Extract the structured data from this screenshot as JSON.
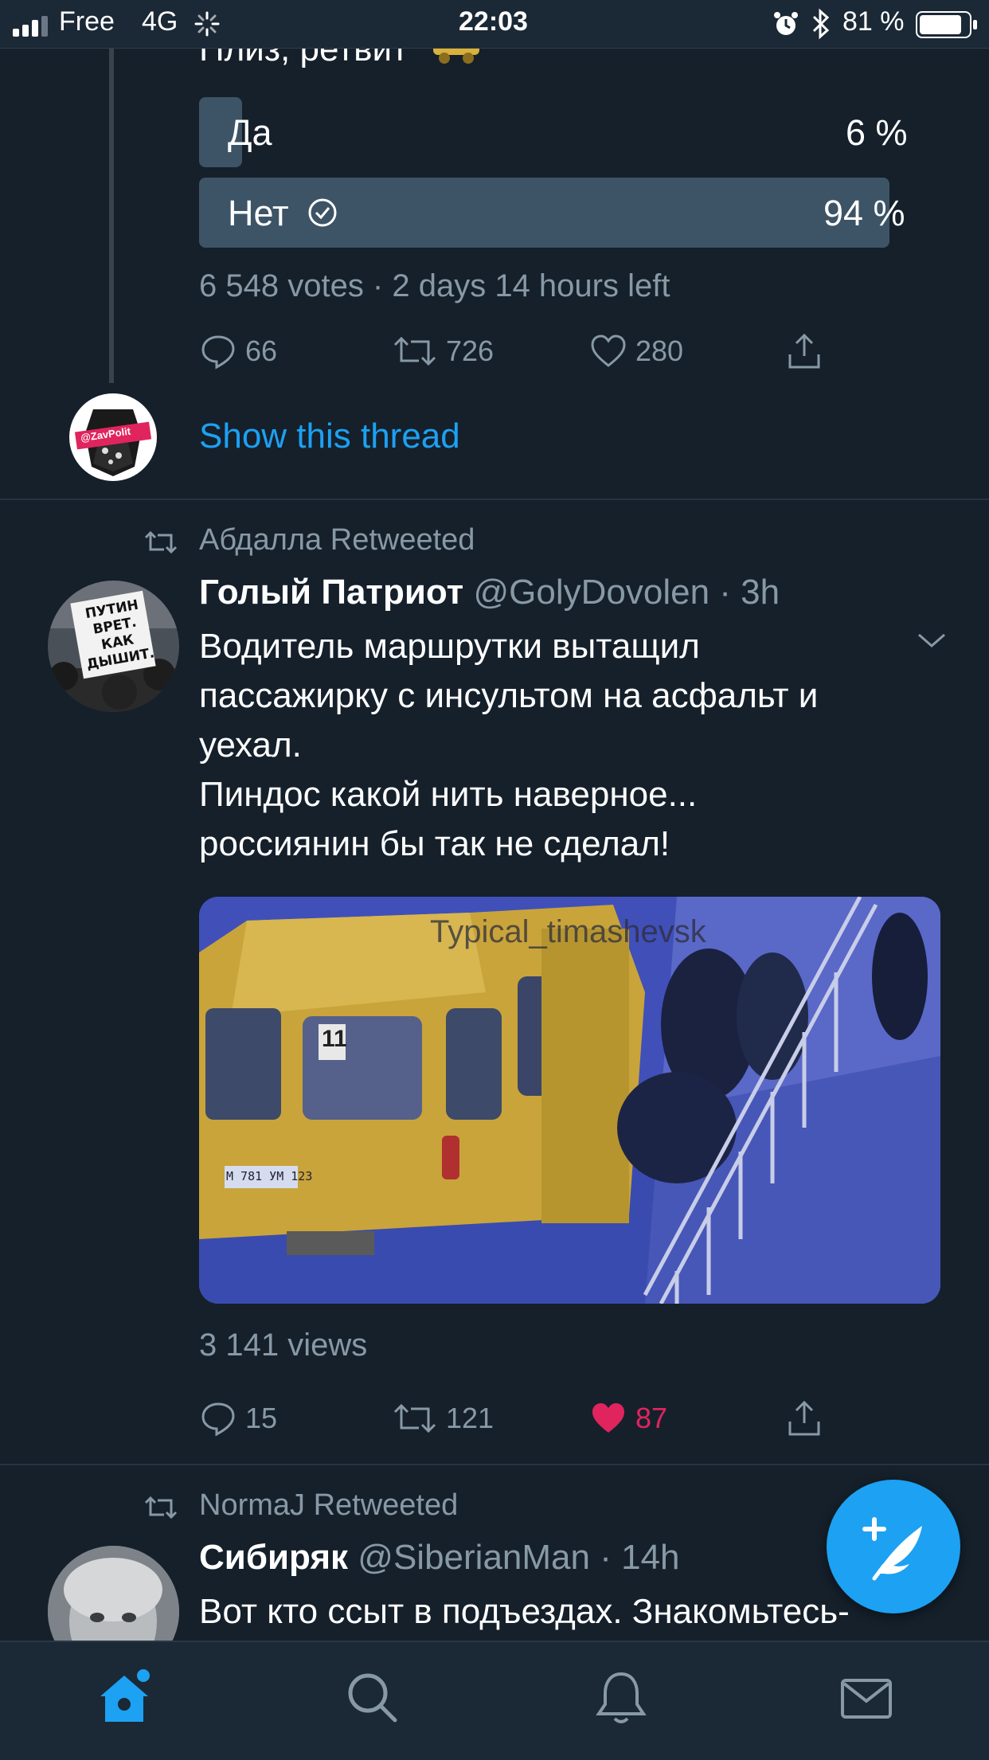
{
  "status_bar": {
    "carrier": "Free",
    "network": "4G",
    "time": "22:03",
    "battery": "81 %"
  },
  "poll_tweet": {
    "text_partial": "Плиз, ретвит",
    "options": [
      {
        "label": "Да",
        "percent_text": "6 %",
        "percent": 6
      },
      {
        "label": "Нет",
        "percent_text": "94 %",
        "percent": 94,
        "selected": true
      }
    ],
    "meta": "6 548 votes · 2 days 14 hours left",
    "actions": {
      "replies": "66",
      "retweets": "726",
      "likes": "280"
    },
    "avatar_text": "@ZavPolit",
    "show_thread": "Show this thread"
  },
  "tweet1": {
    "retweeted_by": "Абдалла Retweeted",
    "name": "Голый Патриот",
    "handle": "@GolyDovolen",
    "time": "· 3h",
    "text_lines": [
      "Водитель маршрутки вытащил",
      "пассажирку с инсультом на асфальт и",
      "уехал.",
      "Пиндос какой нить наверное...",
      "россиянин бы так не сделал!"
    ],
    "avatar_sign_lines": [
      "ПУТИН",
      "ВРЕТ.",
      "КАК",
      "ДЫШИТ."
    ],
    "media_watermark": "Typical_timashevsk",
    "media_route_number": "11",
    "media_plate": "М 781 УМ 123",
    "views": "3 141 views",
    "actions": {
      "replies": "15",
      "retweets": "121",
      "likes": "87"
    }
  },
  "tweet2": {
    "retweeted_by": "NormaJ Retweeted",
    "name": "Сибиряк",
    "handle": "@SiberianMan",
    "time": "· 14h",
    "text_partial": "Вот кто ссыт в подъездах. Знакомьтесь-"
  },
  "icons": {
    "reply": "reply-icon",
    "retweet": "retweet-icon",
    "like": "heart-icon",
    "share": "share-icon",
    "compose": "compose-icon",
    "tabs": [
      "home-icon",
      "search-icon",
      "bell-icon",
      "mail-icon"
    ]
  },
  "colors": {
    "background": "#15202b",
    "bar_background": "#1b2836",
    "accent": "#1da1f2",
    "like_active": "#e0245e",
    "muted": "#8899a6",
    "poll_bar": "#3d5466"
  }
}
